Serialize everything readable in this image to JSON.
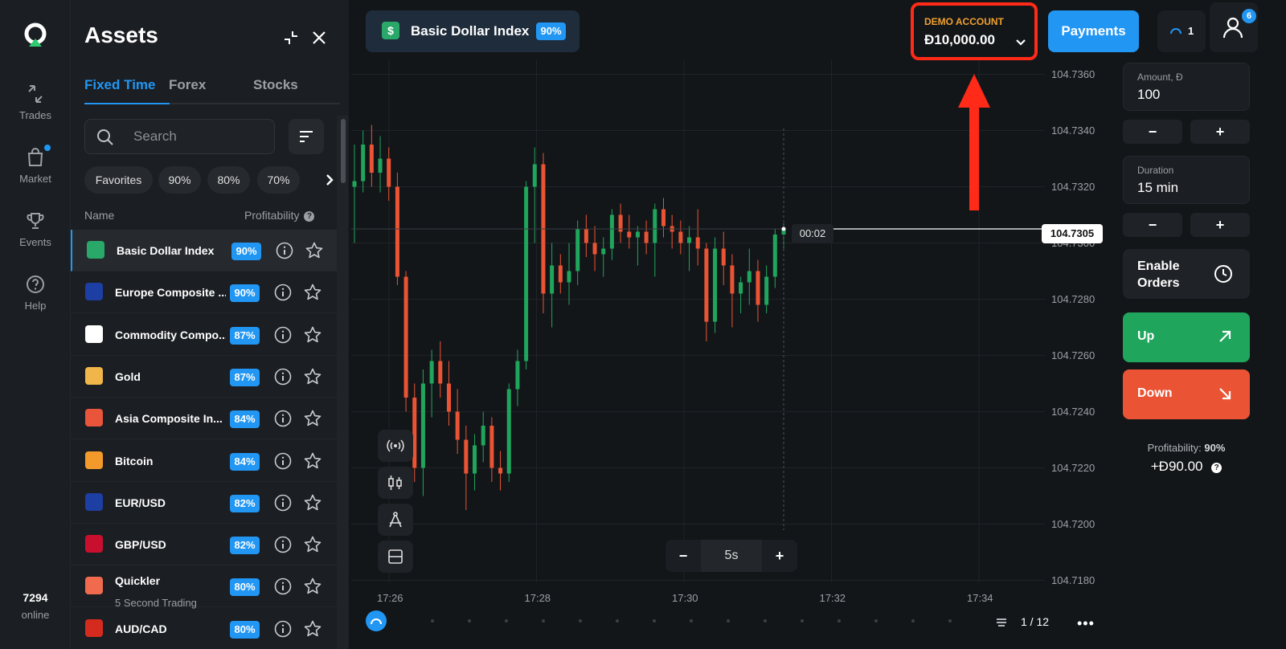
{
  "rail": {
    "items": [
      {
        "label": "Trades",
        "icon": "trades-icon"
      },
      {
        "label": "Market",
        "icon": "market-icon"
      },
      {
        "label": "Events",
        "icon": "trophy-icon"
      },
      {
        "label": "Help",
        "icon": "help-icon"
      }
    ],
    "online_count": "7294",
    "online_label": "online"
  },
  "assets": {
    "title": "Assets",
    "tabs": [
      "Fixed Time",
      "Forex",
      "Stocks"
    ],
    "search_placeholder": "Search",
    "chips": [
      "Favorites",
      "90%",
      "80%",
      "70%"
    ],
    "col_name": "Name",
    "col_profit": "Profitability",
    "rows": [
      {
        "name": "Basic Dollar Index",
        "sub": "",
        "profit": "90%",
        "color": "#2aa86a"
      },
      {
        "name": "Europe Composite ...",
        "sub": "",
        "profit": "90%",
        "color": "#1d3ea3"
      },
      {
        "name": "Commodity Compo...",
        "sub": "",
        "profit": "87%",
        "color": "#ffffff"
      },
      {
        "name": "Gold",
        "sub": "",
        "profit": "87%",
        "color": "#f0b64a"
      },
      {
        "name": "Asia Composite In...",
        "sub": "",
        "profit": "84%",
        "color": "#e8553a"
      },
      {
        "name": "Bitcoin",
        "sub": "",
        "profit": "84%",
        "color": "#f39a2b"
      },
      {
        "name": "EUR/USD",
        "sub": "",
        "profit": "82%",
        "color": "#1d3ea3"
      },
      {
        "name": "GBP/USD",
        "sub": "",
        "profit": "82%",
        "color": "#c8102e"
      },
      {
        "name": "Quickler",
        "sub": "5 Second Trading",
        "profit": "80%",
        "color": "#f06a4e"
      },
      {
        "name": "AUD/CAD",
        "sub": "",
        "profit": "80%",
        "color": "#d52b1e"
      }
    ]
  },
  "topbar": {
    "asset_name": "Basic Dollar Index",
    "asset_profit": "90%",
    "account_label": "DEMO ACCOUNT",
    "balance": "Đ10,000.00",
    "payments": "Payments",
    "open_trades": "1",
    "notifications": "6"
  },
  "trade": {
    "amount_label": "Amount, Đ",
    "amount": "100",
    "duration_label": "Duration",
    "duration": "15 min",
    "minus": "−",
    "plus": "+",
    "enable_orders": "Enable Orders",
    "up": "Up",
    "down": "Down",
    "profitability_label": "Profitability:",
    "profitability_value": "90%",
    "payout": "+Đ90.00"
  },
  "chart_data": {
    "type": "candlestick",
    "title": "",
    "ylim": [
      104.7175,
      104.7365
    ],
    "y_ticks": [
      "104.7360",
      "104.7340",
      "104.7320",
      "104.7300",
      "104.7280",
      "104.7260",
      "104.7240",
      "104.7220",
      "104.7200",
      "104.7180"
    ],
    "x_ticks": [
      "17:26",
      "17:28",
      "17:30",
      "17:32",
      "17:34"
    ],
    "current_price": "104.7305",
    "timer": "00:02",
    "timeframe": "5s",
    "page": "1 / 12",
    "colors": {
      "up": "#1fa55c",
      "down": "#ea5434"
    },
    "candles": [
      [
        104.732,
        104.7335,
        104.73,
        104.7322
      ],
      [
        104.7322,
        104.734,
        104.7318,
        104.7335
      ],
      [
        104.7335,
        104.7342,
        104.732,
        104.7325
      ],
      [
        104.7325,
        104.7338,
        104.7318,
        104.733
      ],
      [
        104.733,
        104.7334,
        104.7315,
        104.732
      ],
      [
        104.732,
        104.7325,
        104.7285,
        104.7288
      ],
      [
        104.7288,
        104.729,
        104.724,
        104.7245
      ],
      [
        104.7245,
        104.725,
        104.7215,
        104.722
      ],
      [
        104.722,
        104.7255,
        104.721,
        104.725
      ],
      [
        104.725,
        104.7262,
        104.7238,
        104.7258
      ],
      [
        104.7258,
        104.7265,
        104.7245,
        104.725
      ],
      [
        104.725,
        104.7258,
        104.7235,
        104.724
      ],
      [
        104.724,
        104.7248,
        104.7225,
        104.723
      ],
      [
        104.723,
        104.7235,
        104.7205,
        104.7218
      ],
      [
        104.7218,
        104.7232,
        104.7212,
        104.7228
      ],
      [
        104.7228,
        104.724,
        104.7222,
        104.7235
      ],
      [
        104.7235,
        104.7238,
        104.7215,
        104.722
      ],
      [
        104.722,
        104.7226,
        104.7212,
        104.7218
      ],
      [
        104.7218,
        104.725,
        104.7215,
        104.7248
      ],
      [
        104.7248,
        104.7262,
        104.7242,
        104.7258
      ],
      [
        104.7258,
        104.7322,
        104.7255,
        104.732
      ],
      [
        104.732,
        104.7334,
        104.73,
        104.7328
      ],
      [
        104.7328,
        104.7332,
        104.7275,
        104.7282
      ],
      [
        104.7282,
        104.73,
        104.727,
        104.7292
      ],
      [
        104.7292,
        104.7296,
        104.7282,
        104.7286
      ],
      [
        104.7286,
        104.73,
        104.7278,
        104.729
      ],
      [
        104.729,
        104.7308,
        104.7285,
        104.7305
      ],
      [
        104.7305,
        104.731,
        104.7295,
        104.73
      ],
      [
        104.73,
        104.7306,
        104.729,
        104.7296
      ],
      [
        104.7296,
        104.7302,
        104.7288,
        104.7298
      ],
      [
        104.7298,
        104.7312,
        104.7294,
        104.731
      ],
      [
        104.731,
        104.7314,
        104.73,
        104.7304
      ],
      [
        104.7304,
        104.731,
        104.7298,
        104.7302
      ],
      [
        104.7302,
        104.7306,
        104.7292,
        104.7304
      ],
      [
        104.7304,
        104.7308,
        104.7296,
        104.73
      ],
      [
        104.73,
        104.7314,
        104.7288,
        104.7312
      ],
      [
        104.7312,
        104.7316,
        104.7302,
        104.7306
      ],
      [
        104.7306,
        104.731,
        104.7298,
        104.7304
      ],
      [
        104.7304,
        104.7308,
        104.7296,
        104.73
      ],
      [
        104.73,
        104.7306,
        104.729,
        104.7302
      ],
      [
        104.7302,
        104.7312,
        104.7292,
        104.7298
      ],
      [
        104.7298,
        104.73,
        104.7265,
        104.7272
      ],
      [
        104.7272,
        104.7302,
        104.7268,
        104.7298
      ],
      [
        104.7298,
        104.7304,
        104.7285,
        104.7292
      ],
      [
        104.7292,
        104.7296,
        104.727,
        104.7282
      ],
      [
        104.7282,
        104.7288,
        104.7275,
        104.7286
      ],
      [
        104.7286,
        104.7298,
        104.7278,
        104.729
      ],
      [
        104.729,
        104.7294,
        104.7272,
        104.7278
      ],
      [
        104.7278,
        104.7292,
        104.7275,
        104.7288
      ],
      [
        104.7288,
        104.7305,
        104.7284,
        104.7303
      ],
      [
        104.7303,
        104.7307,
        104.7298,
        104.7305
      ]
    ]
  }
}
